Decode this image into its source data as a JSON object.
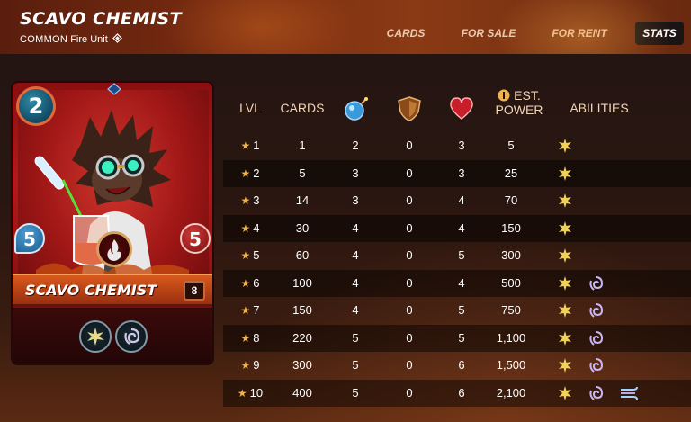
{
  "card": {
    "title": "SCAVO CHEMIST",
    "rarity": "COMMON",
    "element_text": "Fire Unit",
    "mana": "2",
    "speed": "5",
    "health": "5",
    "name_plate": "SCAVO CHEMIST",
    "level": "8",
    "gem_icon": "diamond-icon"
  },
  "tabs": [
    {
      "label": "CARDS",
      "active": false
    },
    {
      "label": "FOR SALE",
      "active": false
    },
    {
      "label": "FOR RENT",
      "active": false
    },
    {
      "label": "STATS",
      "active": true
    }
  ],
  "table": {
    "headers": {
      "lvl": "LVL",
      "cards": "CARDS",
      "attack_icon": "magic-attack-icon",
      "armor_icon": "shield-icon",
      "health_icon": "heart-icon",
      "power_info_icon": "info-icon",
      "power_line1": "EST.",
      "power_line2": "POWER",
      "abilities": "ABILITIES"
    },
    "rows": [
      {
        "lvl": "1",
        "cards": "1",
        "magic": "2",
        "armor": "0",
        "health": "3",
        "power": "5",
        "abilities": [
          "blast-ability-icon"
        ]
      },
      {
        "lvl": "2",
        "cards": "5",
        "magic": "3",
        "armor": "0",
        "health": "3",
        "power": "25",
        "abilities": [
          "blast-ability-icon"
        ]
      },
      {
        "lvl": "3",
        "cards": "14",
        "magic": "3",
        "armor": "0",
        "health": "4",
        "power": "70",
        "abilities": [
          "blast-ability-icon"
        ]
      },
      {
        "lvl": "4",
        "cards": "30",
        "magic": "4",
        "armor": "0",
        "health": "4",
        "power": "150",
        "abilities": [
          "blast-ability-icon"
        ]
      },
      {
        "lvl": "5",
        "cards": "60",
        "magic": "4",
        "armor": "0",
        "health": "5",
        "power": "300",
        "abilities": [
          "blast-ability-icon"
        ]
      },
      {
        "lvl": "6",
        "cards": "100",
        "magic": "4",
        "armor": "0",
        "health": "4",
        "power": "500",
        "abilities": [
          "blast-ability-icon",
          "swirl-ability-icon"
        ]
      },
      {
        "lvl": "7",
        "cards": "150",
        "magic": "4",
        "armor": "0",
        "health": "5",
        "power": "750",
        "abilities": [
          "blast-ability-icon",
          "swirl-ability-icon"
        ]
      },
      {
        "lvl": "8",
        "cards": "220",
        "magic": "5",
        "armor": "0",
        "health": "5",
        "power": "1,100",
        "abilities": [
          "blast-ability-icon",
          "swirl-ability-icon"
        ]
      },
      {
        "lvl": "9",
        "cards": "300",
        "magic": "5",
        "armor": "0",
        "health": "6",
        "power": "1,500",
        "abilities": [
          "blast-ability-icon",
          "swirl-ability-icon"
        ]
      },
      {
        "lvl": "10",
        "cards": "400",
        "magic": "5",
        "armor": "0",
        "health": "6",
        "power": "2,100",
        "abilities": [
          "blast-ability-icon",
          "swirl-ability-icon",
          "wind-ability-icon"
        ]
      }
    ]
  },
  "colors": {
    "header_bg": "#7a2c10",
    "star": "#f0b24a",
    "header_text": "#f3d5b7",
    "active_tab_bg": "#1b1414"
  }
}
